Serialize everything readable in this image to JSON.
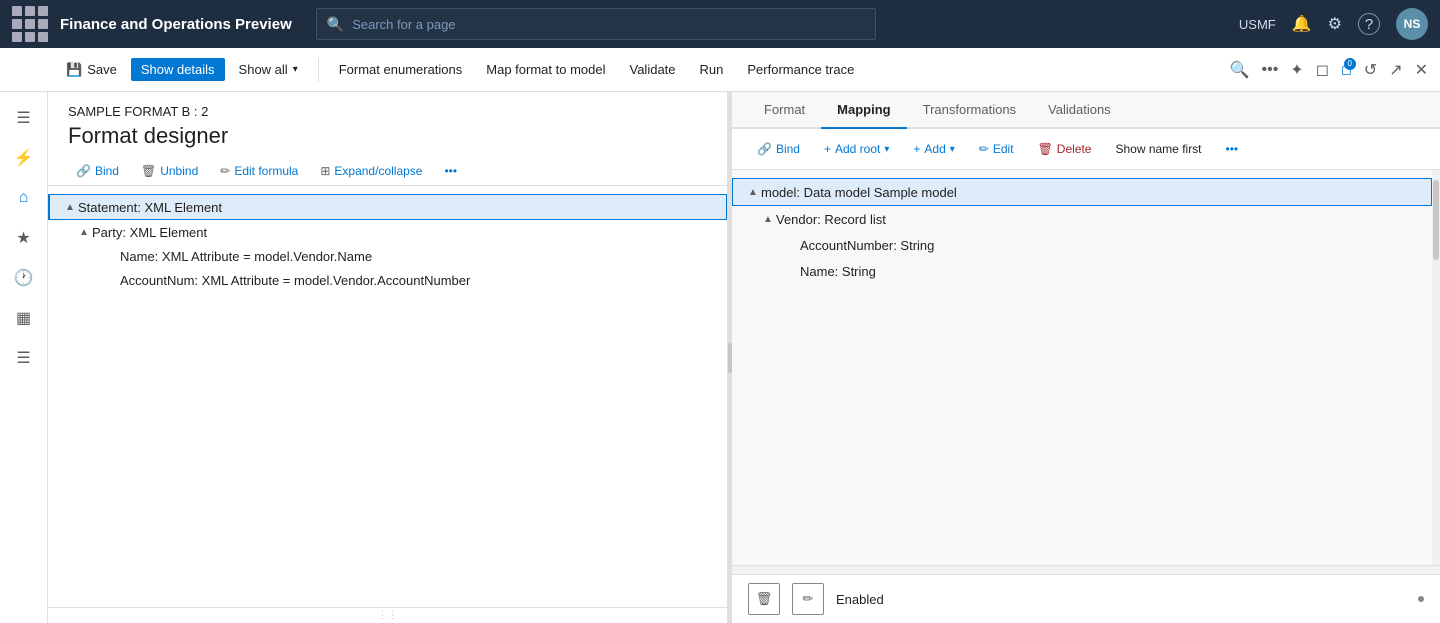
{
  "topnav": {
    "title": "Finance and Operations Preview",
    "search_placeholder": "Search for a page",
    "usmf": "USMF",
    "avatar_initials": "NS"
  },
  "toolbar": {
    "save_label": "Save",
    "show_details_label": "Show details",
    "show_all_label": "Show all",
    "format_enumerations_label": "Format enumerations",
    "map_format_label": "Map format to model",
    "validate_label": "Validate",
    "run_label": "Run",
    "performance_trace_label": "Performance trace"
  },
  "breadcrumb": "SAMPLE FORMAT B : 2",
  "page_title": "Format designer",
  "format_toolbar": {
    "bind_label": "Bind",
    "unbind_label": "Unbind",
    "edit_formula_label": "Edit formula",
    "expand_collapse_label": "Expand/collapse"
  },
  "tree": {
    "items": [
      {
        "label": "Statement: XML Element",
        "indent": 0,
        "toggle": "▲",
        "selected": true
      },
      {
        "label": "Party: XML Element",
        "indent": 1,
        "toggle": "▲",
        "selected": false
      },
      {
        "label": "Name: XML Attribute = model.Vendor.Name",
        "indent": 2,
        "toggle": "",
        "selected": false
      },
      {
        "label": "AccountNum: XML Attribute = model.Vendor.AccountNumber",
        "indent": 2,
        "toggle": "",
        "selected": false
      }
    ]
  },
  "tabs": {
    "items": [
      {
        "label": "Format",
        "active": false
      },
      {
        "label": "Mapping",
        "active": true
      },
      {
        "label": "Transformations",
        "active": false
      },
      {
        "label": "Validations",
        "active": false
      }
    ]
  },
  "mapping_toolbar": {
    "bind_label": "Bind",
    "add_root_label": "Add root",
    "add_label": "Add",
    "edit_label": "Edit",
    "delete_label": "Delete",
    "show_name_first_label": "Show name first"
  },
  "model_tree": {
    "items": [
      {
        "label": "model: Data model Sample model",
        "indent": 0,
        "toggle": "▲",
        "selected": true
      },
      {
        "label": "Vendor: Record list",
        "indent": 1,
        "toggle": "▲",
        "selected": false
      },
      {
        "label": "AccountNumber: String",
        "indent": 2,
        "toggle": "",
        "selected": false
      },
      {
        "label": "Name: String",
        "indent": 2,
        "toggle": "",
        "selected": false
      }
    ]
  },
  "bottom_bar": {
    "enabled_label": "Enabled"
  },
  "icons": {
    "search": "🔍",
    "bell": "🔔",
    "gear": "⚙",
    "help": "?",
    "home": "⌂",
    "star": "★",
    "clock": "🕐",
    "table": "▦",
    "list": "☰",
    "filter": "⚡",
    "save": "💾",
    "link": "🔗",
    "trash": "🗑",
    "pencil": "✏",
    "formula": "𝑓",
    "expand": "⊞",
    "more": "•••",
    "connect": "⊕",
    "bookmark": "⊘",
    "notifications_count": "0",
    "refresh": "↺",
    "openexternal": "↗",
    "close": "✕"
  }
}
